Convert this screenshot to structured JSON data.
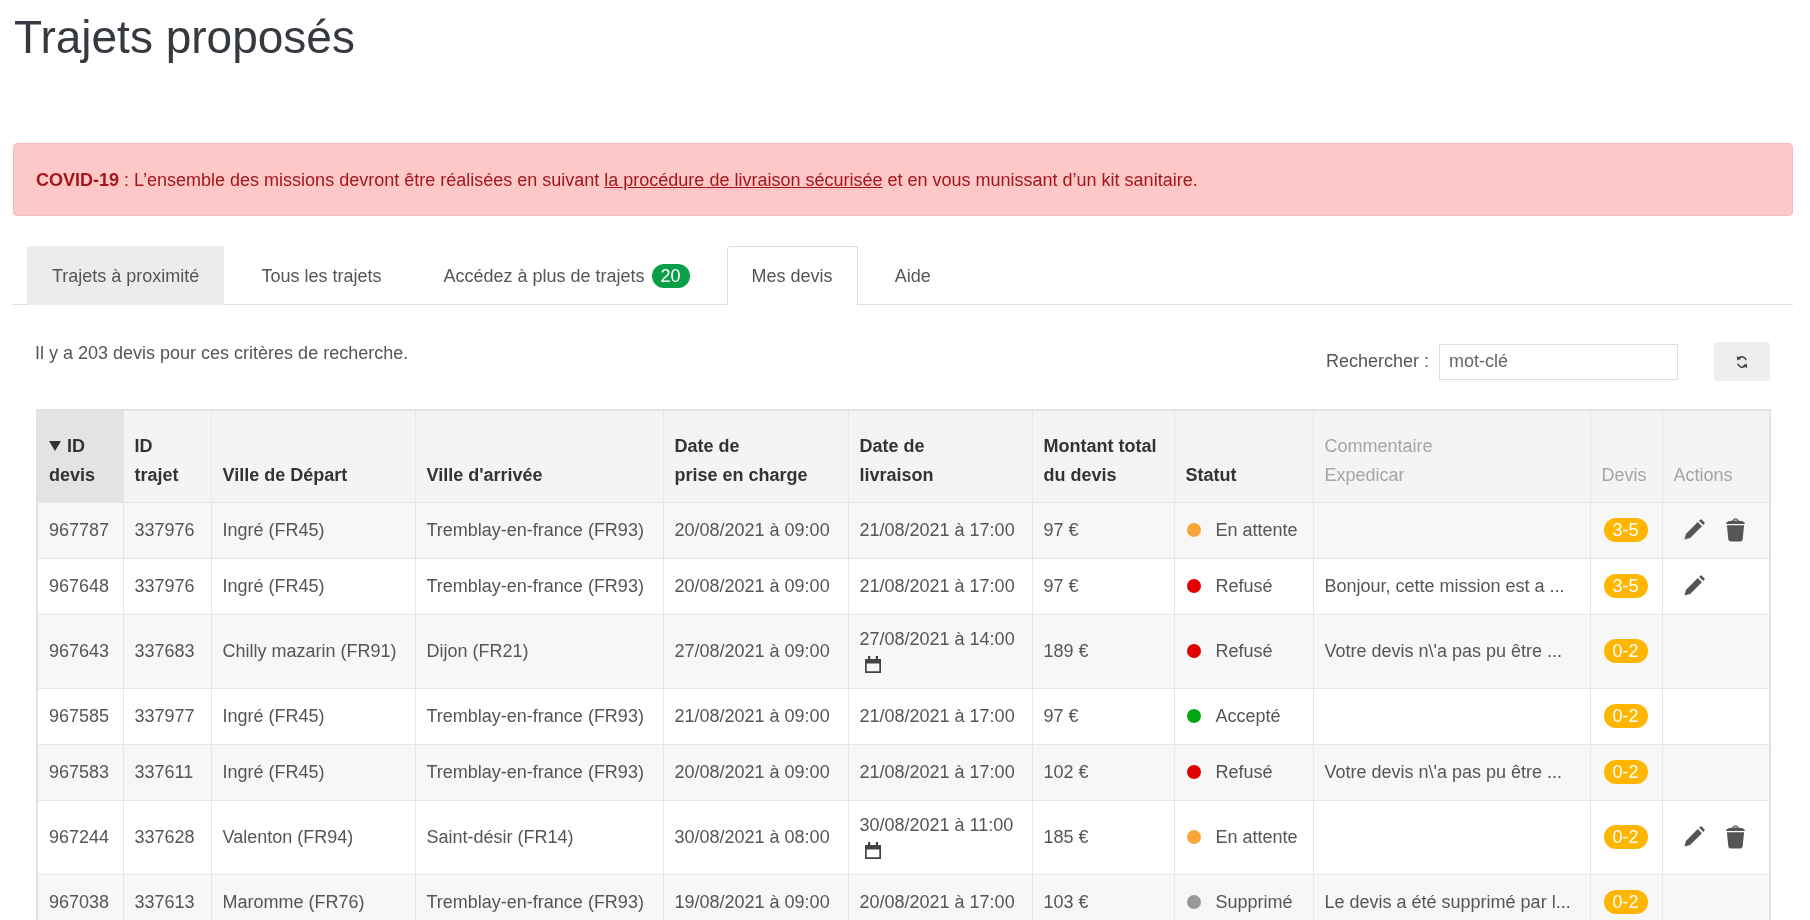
{
  "page": {
    "title": "Trajets proposés"
  },
  "alert": {
    "text_before": "**COVID-19** : L’ensemble des missions devront être réalisées en suivant",
    "link": "la procédure de livraison sécurisée",
    "text_after": "et en vous munissant d’un kit sanitaire."
  },
  "tabs": [
    {
      "label": "Trajets à proximité",
      "selected": false,
      "highlighted": true
    },
    {
      "label": "Tous les trajets",
      "selected": false,
      "highlighted": false
    },
    {
      "label": "Accédez à plus de trajets",
      "badge": "20",
      "selected": false,
      "highlighted": false
    },
    {
      "label": "Mes devis",
      "selected": true,
      "highlighted": false
    },
    {
      "label": "Aide",
      "selected": false,
      "highlighted": false
    }
  ],
  "results_summary": "Il y a 203 devis pour ces critères de recherche.",
  "search": {
    "label": "Rechercher :",
    "placeholder": "mot-clé"
  },
  "table": {
    "columns": [
      {
        "label": "ID\ndevis",
        "sortable": true,
        "sorted": true
      },
      {
        "label": "ID\ntrajet",
        "sortable": true,
        "sorted": false
      },
      {
        "label": "Ville de Départ",
        "sortable": true,
        "sorted": false
      },
      {
        "label": "Ville d'arrivée",
        "sortable": true,
        "sorted": false
      },
      {
        "label": "Date de\nprise en charge",
        "sortable": true,
        "sorted": false
      },
      {
        "label": "Date de\nlivraison",
        "sortable": true,
        "sorted": false
      },
      {
        "label": "Montant total\ndu devis",
        "sortable": true,
        "sorted": false
      },
      {
        "label": "Statut",
        "sortable": true,
        "sorted": false
      },
      {
        "label": "Commentaire\nExpedicar",
        "sortable": false,
        "sorted": false
      },
      {
        "label": "Devis",
        "sortable": false,
        "sorted": false
      },
      {
        "label": "Actions",
        "sortable": false,
        "sorted": false
      }
    ],
    "rows": [
      {
        "id_devis": "967787",
        "id_trajet": "337976",
        "depart": "Ingré (FR45)",
        "arrivee": "Tremblay-en-france (FR93)",
        "prise_en_charge": "20/08/2021 à 09:00",
        "livraison": "21/08/2021 à 17:00",
        "calendar": false,
        "montant": "97 €",
        "status": {
          "label": "En attente",
          "color": "#f9a53a"
        },
        "devis": "3-5",
        "can_edit": true,
        "can_delete": true
      },
      {
        "id_devis": "967648",
        "id_trajet": "337976",
        "depart": "Ingré (FR45)",
        "arrivee": "Tremblay-en-france (FR93)",
        "prise_en_charge": "20/08/2021 à 09:00",
        "livraison": "21/08/2021 à 17:00",
        "calendar": false,
        "montant": "97 €",
        "status": {
          "label": "Refusé",
          "color": "#e00000"
        },
        "commentaire": "Bonjour, cette mission est a ...",
        "devis": "3-5",
        "can_edit": true,
        "can_delete": false
      },
      {
        "id_devis": "967643",
        "id_trajet": "337683",
        "depart": "Chilly mazarin (FR91)",
        "arrivee": "Dijon (FR21)",
        "prise_en_charge": "27/08/2021 à 09:00",
        "livraison": "27/08/2021 à 14:00",
        "calendar": true,
        "montant": "189 €",
        "status": {
          "label": "Refusé",
          "color": "#e00000"
        },
        "commentaire": "Votre devis n\\'a pas pu être ...",
        "devis": "0-2",
        "can_edit": false,
        "can_delete": false
      },
      {
        "id_devis": "967585",
        "id_trajet": "337977",
        "depart": "Ingré (FR45)",
        "arrivee": "Tremblay-en-france (FR93)",
        "prise_en_charge": "21/08/2021 à 09:00",
        "livraison": "21/08/2021 à 17:00",
        "calendar": false,
        "montant": "97 €",
        "status": {
          "label": "Accepté",
          "color": "#00a814"
        },
        "devis": "0-2",
        "can_edit": false,
        "can_delete": false
      },
      {
        "id_devis": "967583",
        "id_trajet": "337611",
        "depart": "Ingré (FR45)",
        "arrivee": "Tremblay-en-france (FR93)",
        "prise_en_charge": "20/08/2021 à 09:00",
        "livraison": "21/08/2021 à 17:00",
        "calendar": false,
        "montant": "102 €",
        "status": {
          "label": "Refusé",
          "color": "#e00000"
        },
        "commentaire": "Votre devis n\\'a pas pu être ...",
        "devis": "0-2",
        "can_edit": false,
        "can_delete": false
      },
      {
        "id_devis": "967244",
        "id_trajet": "337628",
        "depart": "Valenton (FR94)",
        "arrivee": "Saint-désir (FR14)",
        "prise_en_charge": "30/08/2021 à 08:00",
        "livraison": "30/08/2021 à 11:00",
        "calendar": true,
        "montant": "185 €",
        "status": {
          "label": "En attente",
          "color": "#f9a53a"
        },
        "devis": "0-2",
        "can_edit": true,
        "can_delete": true
      },
      {
        "id_devis": "967038",
        "id_trajet": "337613",
        "depart": "Maromme (FR76)",
        "arrivee": "Tremblay-en-france (FR93)",
        "prise_en_charge": "19/08/2021 à 09:00",
        "livraison": "20/08/2021 à 17:00",
        "calendar": false,
        "montant": "103 €",
        "status": {
          "label": "Supprimé",
          "color": "#999999"
        },
        "commentaire": "Le devis a été supprimé par l...",
        "devis": "0-2",
        "can_edit": false,
        "can_delete": false
      }
    ]
  }
}
